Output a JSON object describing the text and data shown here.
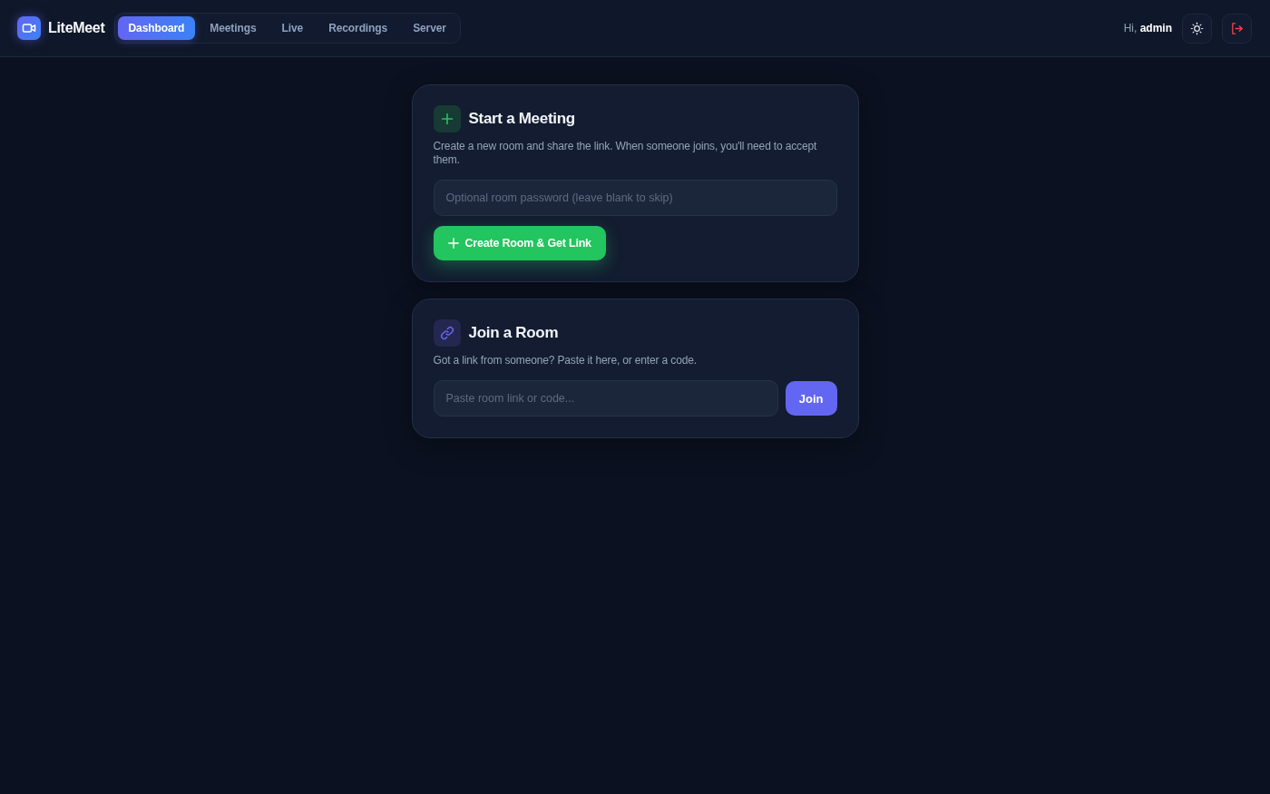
{
  "header": {
    "brand": "LiteMeet",
    "tabs": [
      {
        "label": "Dashboard",
        "selected": true
      },
      {
        "label": "Meetings",
        "selected": false
      },
      {
        "label": "Live",
        "selected": false
      },
      {
        "label": "Recordings",
        "selected": false
      },
      {
        "label": "Server",
        "selected": false
      }
    ],
    "greeting": "Hi, **admin**"
  },
  "start_meeting": {
    "title": "Start a Meeting",
    "description": "Create a new room and share the link. When someone joins, you'll need to accept them.",
    "password_field": {
      "placeholder": "Optional room password (leave blank to skip)"
    },
    "button": "Create Room & Get Link"
  },
  "join_room": {
    "title": "Join a Room",
    "description": "Got a link from someone? Paste it here, or enter a code.",
    "link_field": {
      "placeholder": "Paste room link or code..."
    },
    "button": "Join"
  }
}
